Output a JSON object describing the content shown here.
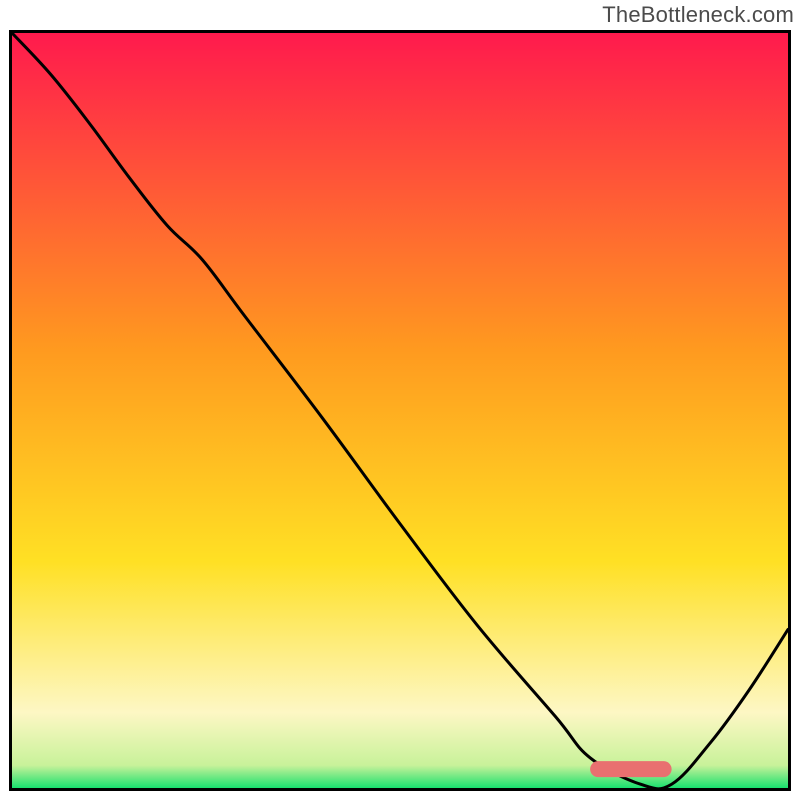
{
  "attribution": "TheBottleneck.com",
  "colors": {
    "top": "#ff1a4d",
    "mid1": "#ff9a1f",
    "mid2": "#ffe024",
    "pale": "#fdf7c4",
    "green": "#18e06e",
    "line": "#000000",
    "marker": "#e97070",
    "frame": "#000000"
  },
  "chart_data": {
    "type": "line",
    "title": "",
    "xlabel": "",
    "ylabel": "",
    "xlim": [
      0,
      100
    ],
    "ylim": [
      0,
      100
    ],
    "series": [
      {
        "name": "bottleneck-curve",
        "x": [
          0,
          5,
          10,
          15,
          20,
          24.5,
          30,
          40,
          50,
          60,
          70,
          74.5,
          81,
          85,
          90,
          95,
          100
        ],
        "y": [
          100,
          94.5,
          88.0,
          81.0,
          74.5,
          70.0,
          62.5,
          49.0,
          35.0,
          21.5,
          9.5,
          4.0,
          0.5,
          0.5,
          6.0,
          13.0,
          21.0
        ]
      }
    ],
    "marker": {
      "x_start": 74.5,
      "x_end": 85,
      "y": 2.5
    },
    "gradient_stops": [
      {
        "pct": 0,
        "color": "#ff1a4d"
      },
      {
        "pct": 42,
        "color": "#ff9a1f"
      },
      {
        "pct": 70,
        "color": "#ffe024"
      },
      {
        "pct": 90,
        "color": "#fdf7c4"
      },
      {
        "pct": 97,
        "color": "#c8f29a"
      },
      {
        "pct": 100,
        "color": "#18e06e"
      }
    ]
  }
}
